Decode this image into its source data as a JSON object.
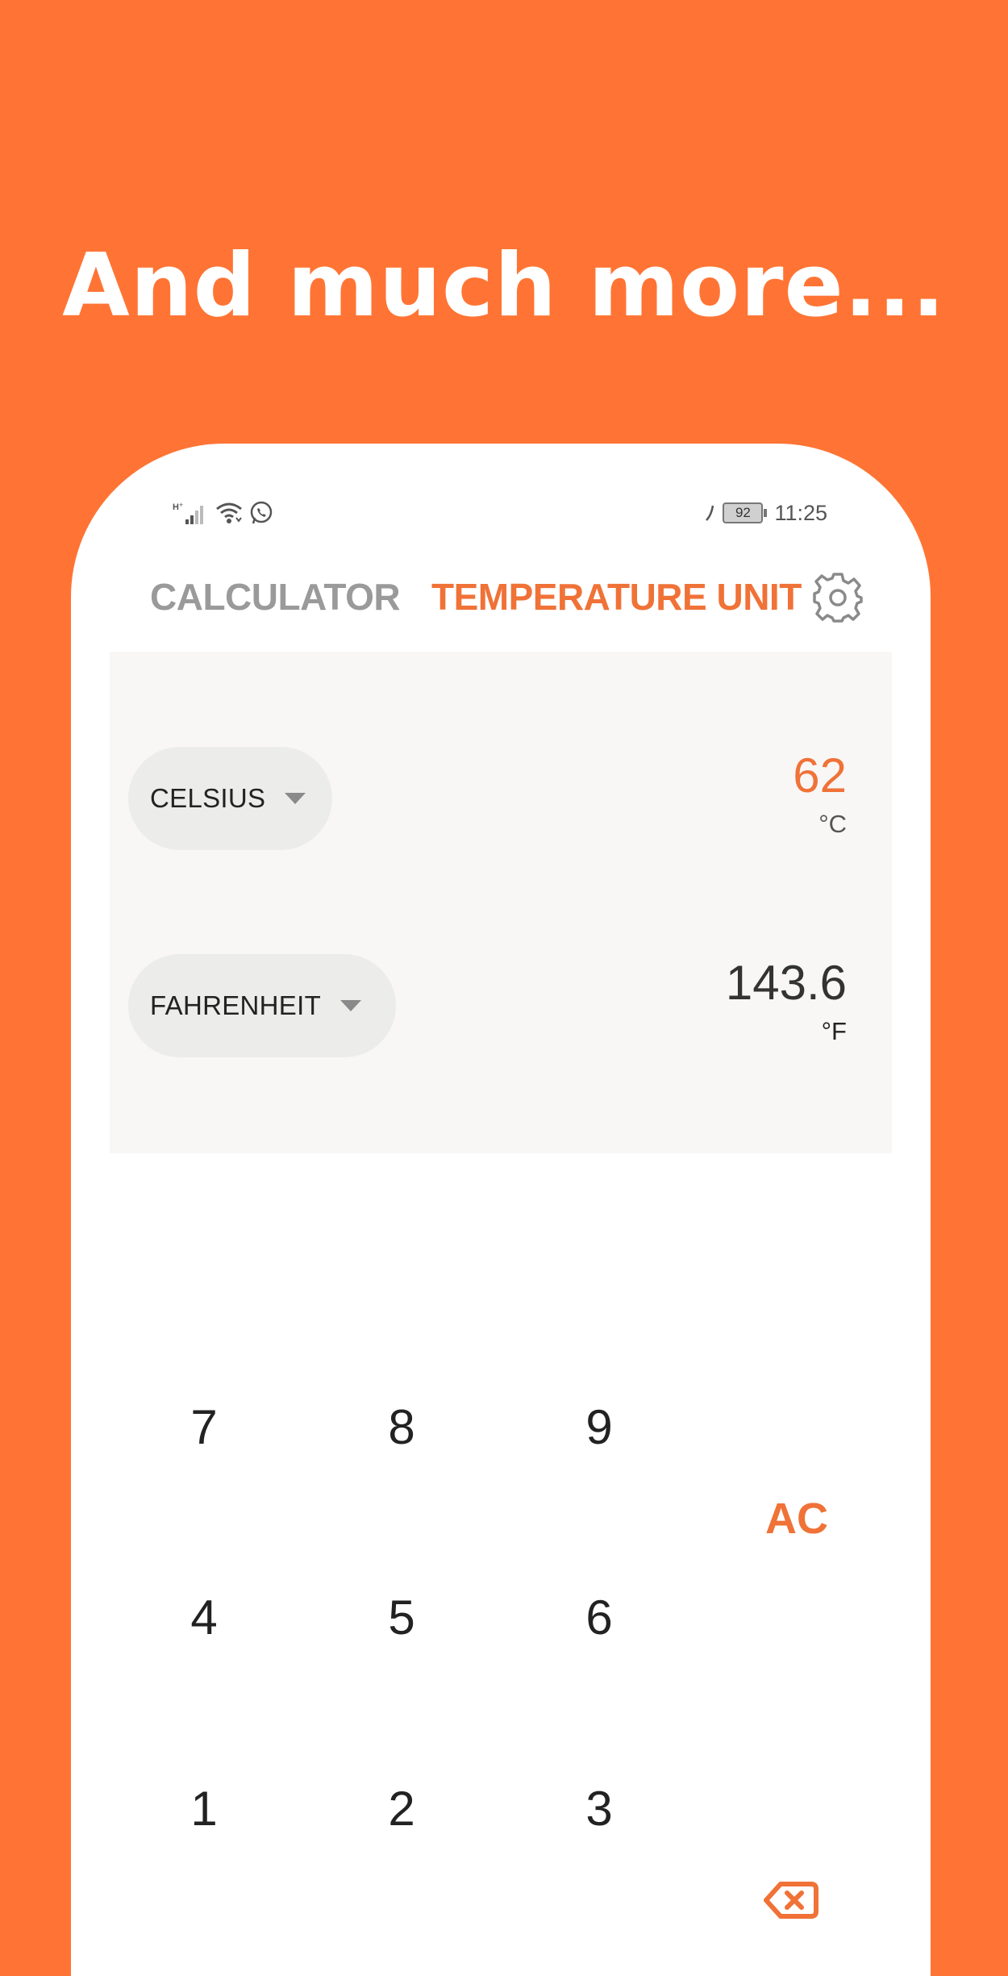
{
  "headline": "And much more...",
  "status_bar": {
    "time": "11:25",
    "battery": "92"
  },
  "tabs": {
    "calculator": "CALCULATOR",
    "temperature": "TEMPERATURE UNIT",
    "active": "temperature"
  },
  "converter": {
    "from": {
      "unit_name": "CELSIUS",
      "value": "62",
      "symbol": "°C"
    },
    "to": {
      "unit_name": "FAHRENHEIT",
      "value": "143.6",
      "symbol": "°F"
    }
  },
  "keypad": {
    "k7": "7",
    "k8": "8",
    "k9": "9",
    "k4": "4",
    "k5": "5",
    "k6": "6",
    "k1": "1",
    "k2": "2",
    "k3": "3",
    "ac": "AC"
  },
  "colors": {
    "background": "#FF7434",
    "accent": "#F07237",
    "inactive_tab": "#9A9A9A",
    "panel": "#F8F7F6"
  },
  "icons": [
    "signal-icon",
    "wifi-icon",
    "whatsapp-icon",
    "headphones-icon",
    "battery-icon",
    "gear-icon",
    "chevron-down-icon",
    "backspace-icon"
  ]
}
